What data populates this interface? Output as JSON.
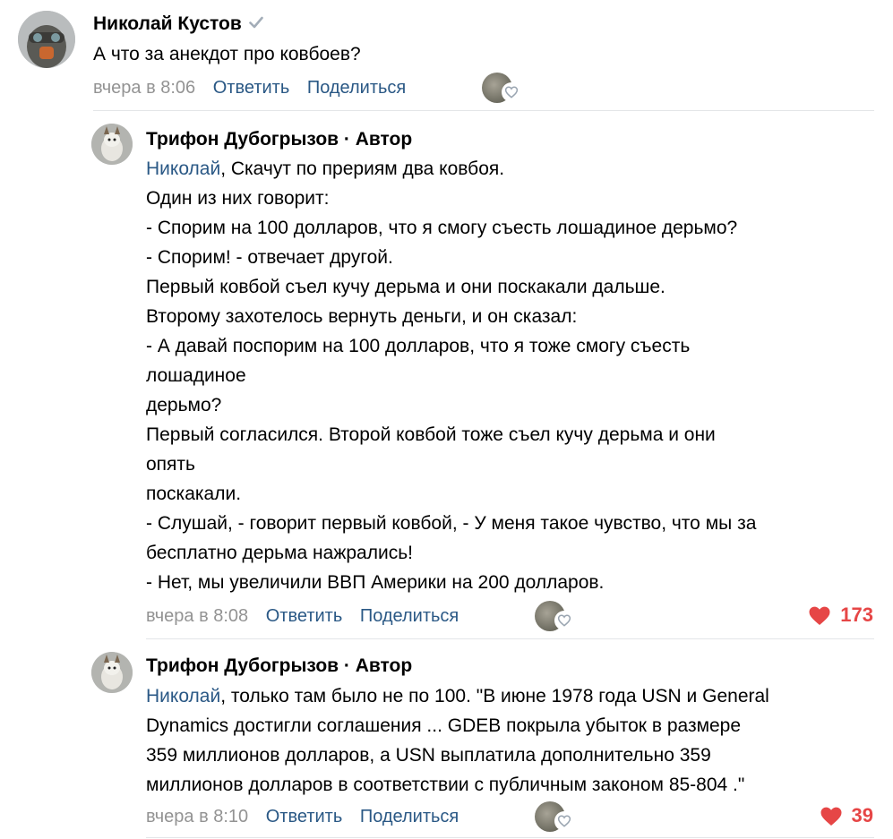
{
  "comment1": {
    "author": "Николай Кустов",
    "text": "А что за анекдот про ковбоев?",
    "time": "вчера в 8:06",
    "reply": "Ответить",
    "share": "Поделиться"
  },
  "reply1": {
    "author": "Трифон Дубогрызов · Автор",
    "mention": "Николай",
    "lines": [
      ", Скачут по прериям два ковбоя.",
      "Один из них говорит:",
      "- Спорим на 100 долларов, что я смогу съесть лошадиное дерьмо?",
      "- Спорим! - отвечает другой.",
      "Первый ковбой съел кучу дерьма и они поскакали дальше.",
      "Второму захотелось вернуть деньги, и он сказал:",
      "- А давай поспорим на 100 долларов, что я тоже смогу съесть",
      "лошадиное",
      "дерьмо?",
      "Первый согласился. Второй ковбой тоже съел кучу дерьма и они",
      "опять",
      "поскакали.",
      "- Слушай, - говорит первый ковбой, - У меня такое чувство, что мы за",
      "бесплатно дерьма нажрались!",
      "- Нет, мы увеличили ВВП Америки на 200 долларов."
    ],
    "time": "вчера в 8:08",
    "reply": "Ответить",
    "share": "Поделиться",
    "likes": "173"
  },
  "reply2": {
    "author": "Трифон Дубогрызов · Автор",
    "mention": "Николай",
    "lines": [
      ", только там было не по 100. \"В июне 1978 года USN и General",
      "Dynamics достигли соглашения ... GDEB покрыла убыток в размере",
      "359 миллионов долларов, а USN выплатила дополнительно 359",
      "миллионов долларов в соответствии с публичным законом 85-804 .\""
    ],
    "time": "вчера в 8:10",
    "reply": "Ответить",
    "share": "Поделиться",
    "likes": "39"
  },
  "colors": {
    "link": "#2a5885",
    "meta": "#939393",
    "like": "#e64646",
    "divider": "#e3e5e8"
  },
  "icons": {
    "verified": "check-icon",
    "like": "heart-icon"
  }
}
